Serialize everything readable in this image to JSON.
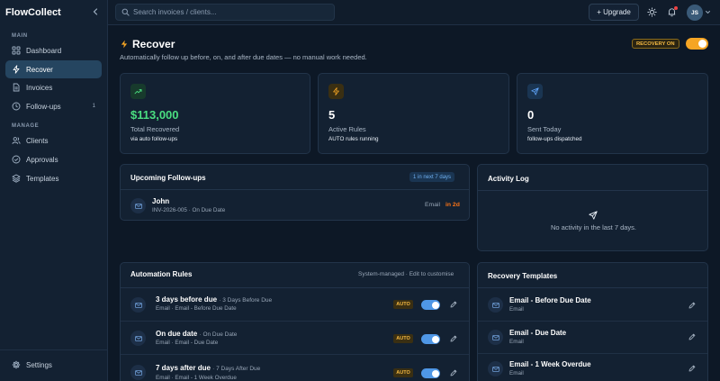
{
  "app": {
    "brand": "FlowCollect"
  },
  "sidebar": {
    "sections": {
      "main": "MAIN",
      "manage": "MANAGE"
    },
    "items": [
      {
        "label": "Dashboard",
        "icon": "grid-icon"
      },
      {
        "label": "Recover",
        "icon": "bolt-icon",
        "active": true
      },
      {
        "label": "Invoices",
        "icon": "file-icon"
      },
      {
        "label": "Follow-ups",
        "icon": "clock-icon",
        "count": "1"
      },
      {
        "label": "Clients",
        "icon": "users-icon"
      },
      {
        "label": "Approvals",
        "icon": "check-circle-icon"
      },
      {
        "label": "Templates",
        "icon": "layers-icon"
      }
    ],
    "settings_label": "Settings"
  },
  "topbar": {
    "search_placeholder": "Search invoices / clients...",
    "upgrade_label": "+ Upgrade",
    "avatar_initials": "JS"
  },
  "page": {
    "title": "Recover",
    "subtitle": "Automatically follow up before, on, and after due dates — no manual work needed.",
    "recovery_badge": "RECOVERY ON"
  },
  "stats": [
    {
      "value": "$113,000",
      "label": "Total Recovered",
      "sub": "via auto follow-ups",
      "icon": "trending-up-icon",
      "color": "#4ade80"
    },
    {
      "value": "5",
      "label": "Active Rules",
      "sub": "AUTO rules running",
      "icon": "bolt-icon",
      "color": "#f5a524"
    },
    {
      "value": "0",
      "label": "Sent Today",
      "sub": "follow-ups dispatched",
      "icon": "send-icon",
      "color": "#60a5fa"
    }
  ],
  "upcoming": {
    "title": "Upcoming Follow-ups",
    "pill": "1 in next 7 days",
    "items": [
      {
        "name": "John",
        "sub": "INV-2026-005 · On Due Date",
        "channel": "Email",
        "due": "in 2d"
      }
    ]
  },
  "activity": {
    "title": "Activity Log",
    "empty": "No activity in the last 7 days."
  },
  "rules": {
    "title": "Automation Rules",
    "meta": "System-managed · Edit to customise",
    "items": [
      {
        "name": "3 days before due",
        "timing": "· 3 Days Before Due",
        "sub": "Email · Email - Before Due Date",
        "tag": "AUTO"
      },
      {
        "name": "On due date",
        "timing": "· On Due Date",
        "sub": "Email · Email - Due Date",
        "tag": "AUTO"
      },
      {
        "name": "7 days after due",
        "timing": "· 7 Days After Due",
        "sub": "Email · Email - 1 Week Overdue",
        "tag": "AUTO"
      }
    ]
  },
  "templates": {
    "title": "Recovery Templates",
    "items": [
      {
        "name": "Email - Before Due Date",
        "sub": "Email"
      },
      {
        "name": "Email - Due Date",
        "sub": "Email"
      },
      {
        "name": "Email - 1 Week Overdue",
        "sub": "Email"
      }
    ]
  }
}
